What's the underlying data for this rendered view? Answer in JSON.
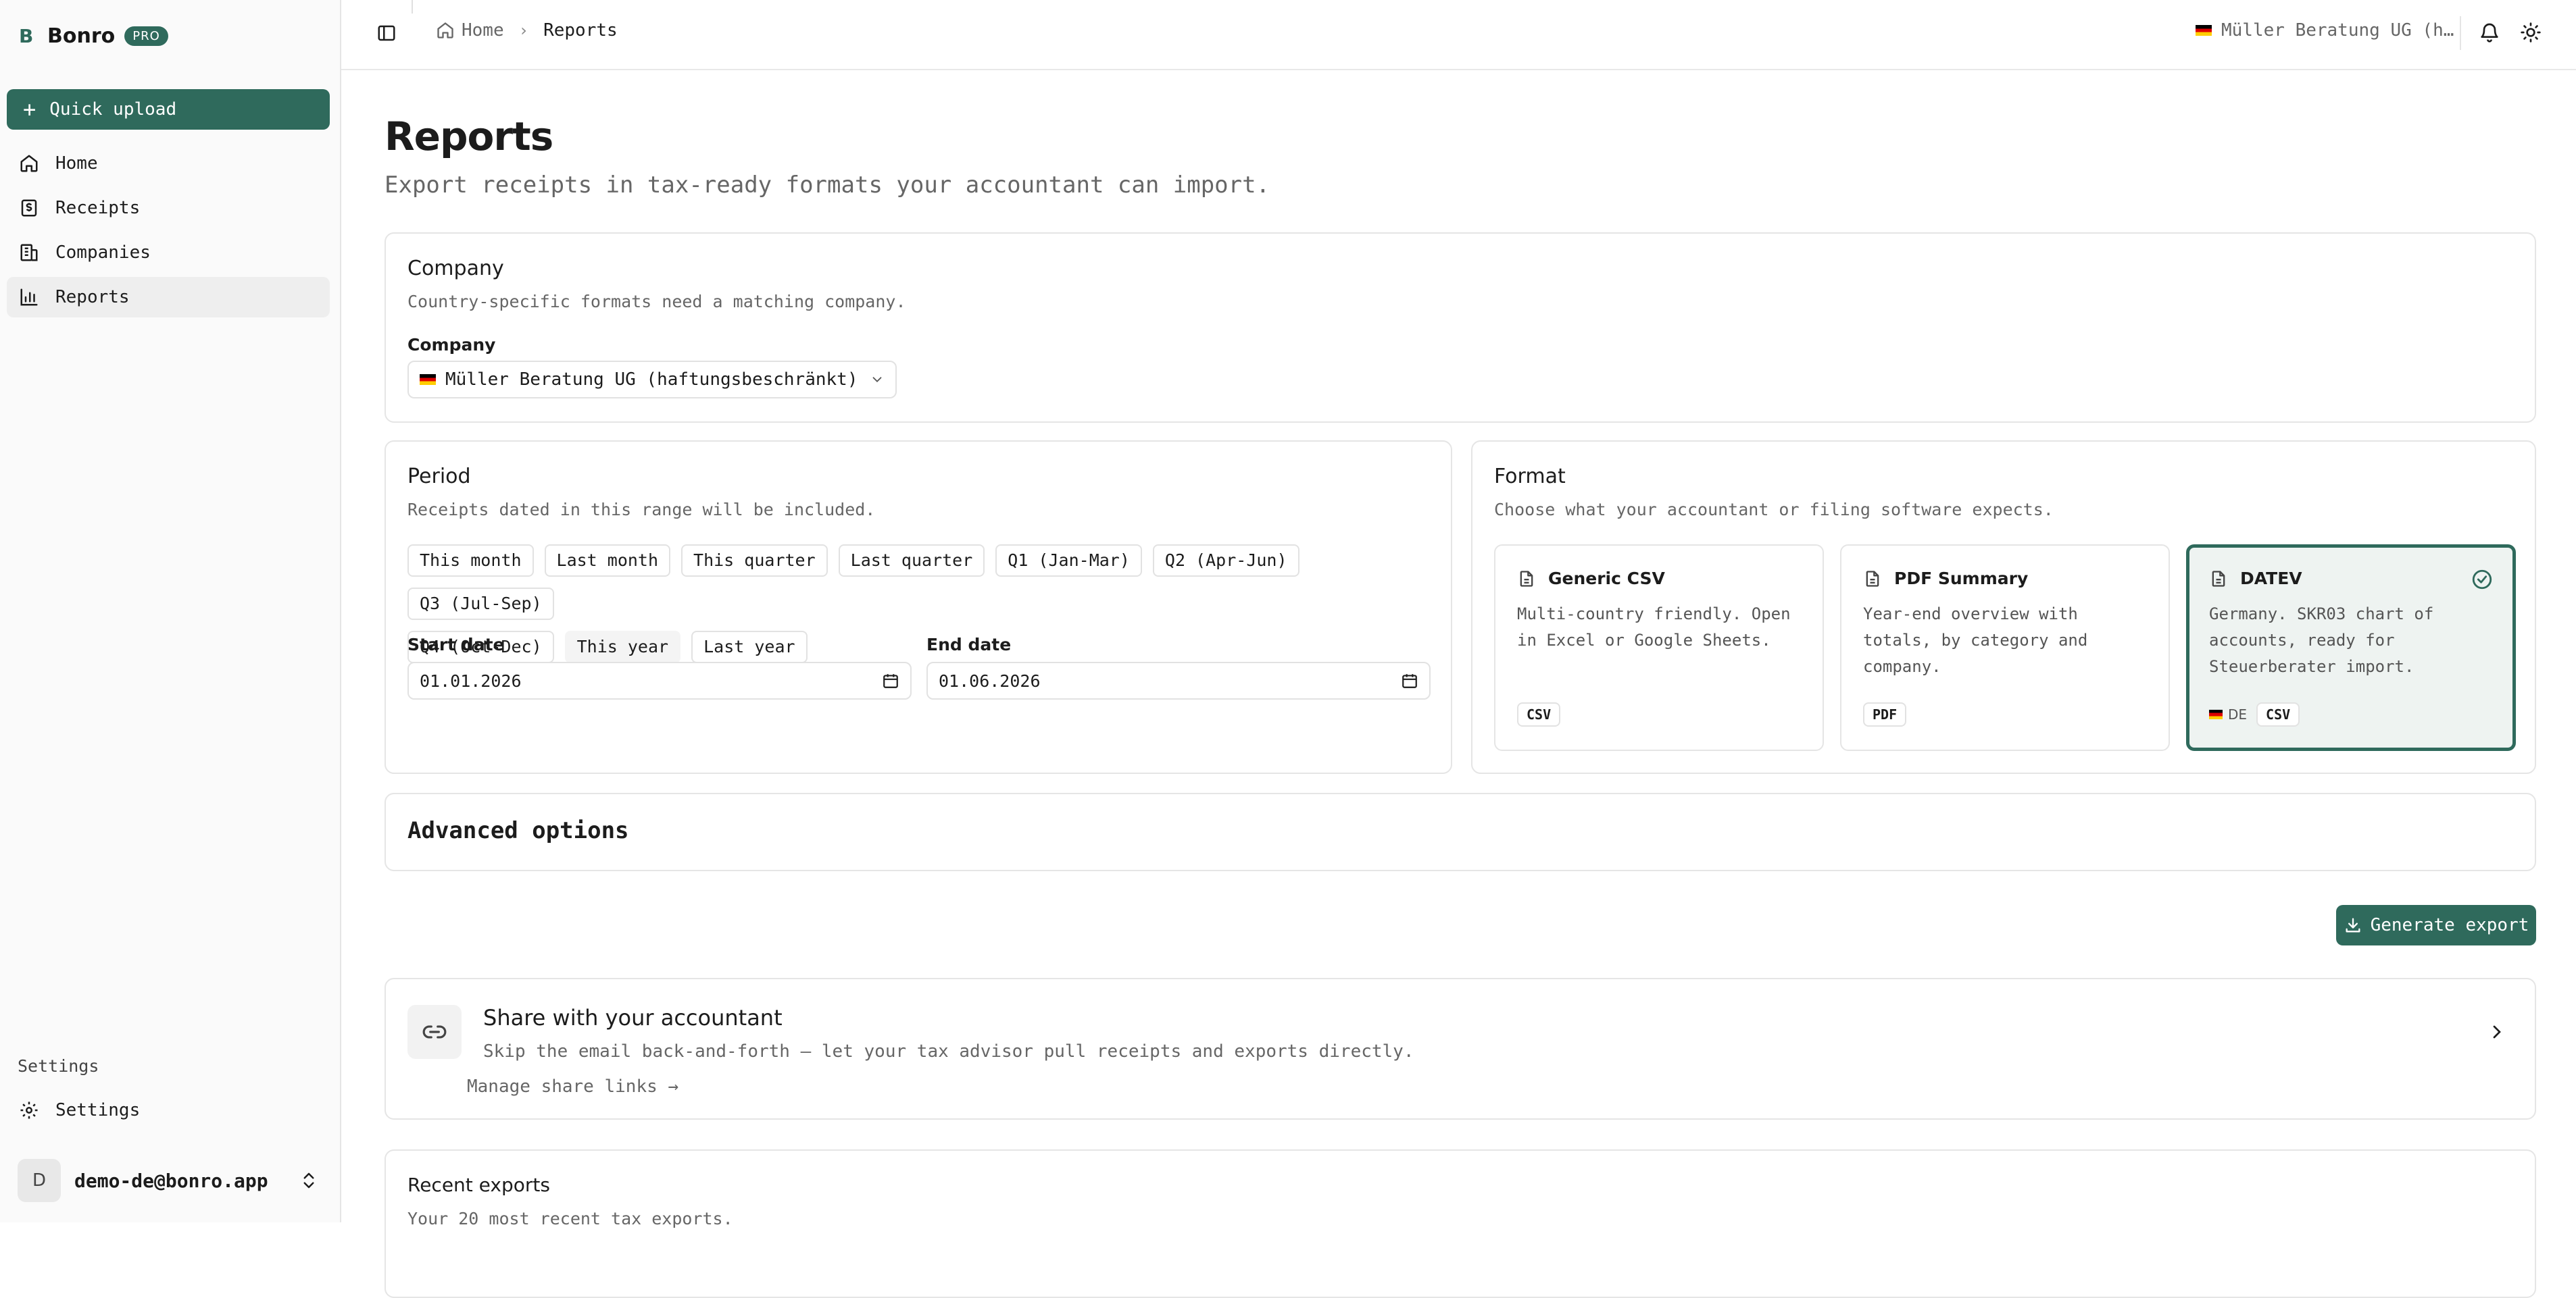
{
  "brand": {
    "mark": "B",
    "name": "Bonro",
    "badge": "PRO"
  },
  "sidebar": {
    "quick_upload": "Quick upload",
    "items": [
      {
        "label": "Home",
        "icon": "home-icon"
      },
      {
        "label": "Receipts",
        "icon": "receipt-icon"
      },
      {
        "label": "Companies",
        "icon": "building-icon"
      },
      {
        "label": "Reports",
        "icon": "bar-chart-icon",
        "active": true
      }
    ],
    "settings_heading": "Settings",
    "settings_item": "Settings",
    "user": {
      "initial": "D",
      "email": "demo-de@bonro.app"
    }
  },
  "topbar": {
    "breadcrumb": {
      "home": "Home",
      "current": "Reports"
    },
    "company": "Müller Beratung UG (h…"
  },
  "page": {
    "title": "Reports",
    "subtitle": "Export receipts in tax-ready formats your accountant can import."
  },
  "company_card": {
    "title": "Company",
    "desc": "Country-specific formats need a matching company.",
    "label": "Company",
    "value": "Müller Beratung UG (haftungsbeschränkt)"
  },
  "period_card": {
    "title": "Period",
    "desc": "Receipts dated in this range will be included.",
    "presets": [
      "This month",
      "Last month",
      "This quarter",
      "Last quarter",
      "Q1 (Jan-Mar)",
      "Q2 (Apr-Jun)",
      "Q3 (Jul-Sep)",
      "Q4 (Oct-Dec)",
      "This year",
      "Last year"
    ],
    "selected_preset": "This year",
    "start_label": "Start date",
    "start_value": "01.01.2026",
    "end_label": "End date",
    "end_value": "01.06.2026"
  },
  "format_card": {
    "title": "Format",
    "desc": "Choose what your accountant or filing software expects.",
    "options": [
      {
        "name": "Generic CSV",
        "desc": "Multi-country friendly. Open in Excel or Google Sheets.",
        "tag": "CSV"
      },
      {
        "name": "PDF Summary",
        "desc": "Year-end overview with totals, by category and company.",
        "tag": "PDF"
      },
      {
        "name": "DATEV",
        "desc": "Germany. SKR03 chart of accounts, ready for Steuerberater import.",
        "country": "DE",
        "tag": "CSV",
        "selected": true
      }
    ]
  },
  "advanced": {
    "title": "Advanced options"
  },
  "generate_button": "Generate export",
  "share": {
    "title": "Share with your accountant",
    "desc": "Skip the email back-and-forth — let your tax advisor pull receipts and exports directly.",
    "link": "Manage share links →"
  },
  "recent": {
    "title": "Recent exports",
    "desc": "Your 20 most recent tax exports."
  },
  "colors": {
    "accent": "#2f6a5c",
    "border": "#e5e5e5",
    "muted_text": "#666666"
  }
}
